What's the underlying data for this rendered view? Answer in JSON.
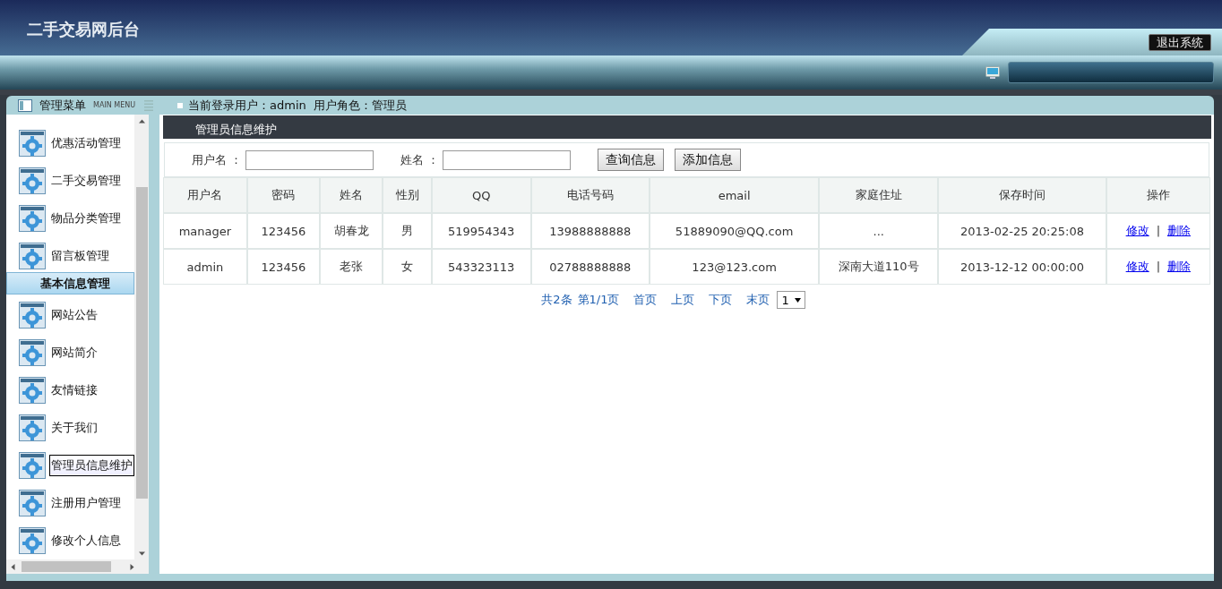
{
  "header": {
    "title": "二手交易网后台",
    "logout_button": "退出系统"
  },
  "menu": {
    "title": "管理菜单",
    "subtitle": "MAIN MENU",
    "items": [
      {
        "kind": "item",
        "label": "优惠活动管理",
        "selected": false
      },
      {
        "kind": "item",
        "label": "二手交易管理",
        "selected": false
      },
      {
        "kind": "item",
        "label": "物品分类管理",
        "selected": false
      },
      {
        "kind": "item",
        "label": "留言板管理",
        "selected": false
      },
      {
        "kind": "section",
        "label": "基本信息管理",
        "selected": false
      },
      {
        "kind": "item",
        "label": "网站公告",
        "selected": false
      },
      {
        "kind": "item",
        "label": "网站简介",
        "selected": false
      },
      {
        "kind": "item",
        "label": "友情链接",
        "selected": false
      },
      {
        "kind": "item",
        "label": "关于我们",
        "selected": false
      },
      {
        "kind": "item",
        "label": "管理员信息维护",
        "selected": true
      },
      {
        "kind": "item",
        "label": "注册用户管理",
        "selected": false
      },
      {
        "kind": "item",
        "label": "修改个人信息",
        "selected": false
      }
    ]
  },
  "user_info": "当前登录用户：admin  用户角色：管理员",
  "panel": {
    "title": "管理员信息维护",
    "filters": [
      {
        "label": "用户名 ："
      },
      {
        "label": "姓名 ："
      }
    ],
    "buttons": [
      "查询信息",
      "添加信息"
    ],
    "table": {
      "columns": [
        "用户名",
        "密码",
        "姓名",
        "性别",
        "QQ",
        "电话号码",
        "email",
        "家庭住址",
        "保存时间",
        "操作"
      ],
      "rows": [
        {
          "cells": [
            "manager",
            "123456",
            "胡春龙",
            "男",
            "519954343",
            "13988888888",
            "51889090@QQ.com",
            "...",
            "2013-02-25 20:25:08"
          ],
          "actions": [
            "修改",
            "删除"
          ],
          "separator": "|"
        },
        {
          "cells": [
            "admin",
            "123456",
            "老张",
            "女",
            "543323113",
            "02788888888",
            "123@123.com",
            "深南大道110号",
            "2013-12-12 00:00:00"
          ],
          "actions": [
            "修改",
            "删除"
          ],
          "separator": "|"
        }
      ]
    },
    "pagination": {
      "links": [
        "共2条",
        "第1/1页",
        "首页",
        "上页",
        "下页",
        "末页"
      ],
      "page_select": "1"
    }
  }
}
